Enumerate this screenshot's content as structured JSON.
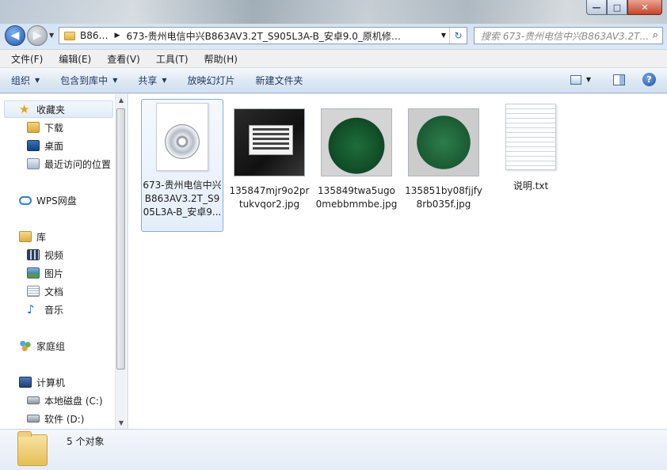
{
  "window": {
    "minimize": "—",
    "maximize": "□",
    "close": "✕"
  },
  "address": {
    "crumb1": "B86…",
    "crumb2": "673-贵州电信中兴B863AV3.2T_S905L3A-B_安卓9.0_原机修…",
    "search_placeholder": "搜索 673-贵州电信中兴B863AV3.2T…"
  },
  "menu": [
    "文件(F)",
    "编辑(E)",
    "查看(V)",
    "工具(T)",
    "帮助(H)"
  ],
  "toolbar": {
    "organize": "组织",
    "include_in_library": "包含到库中",
    "share": "共享",
    "slideshow": "放映幻灯片",
    "new_folder": "新建文件夹"
  },
  "nav": {
    "favorites": "收藏夹",
    "downloads": "下载",
    "desktop": "桌面",
    "recent": "最近访问的位置",
    "wps": "WPS网盘",
    "libraries": "库",
    "videos": "视频",
    "pictures": "图片",
    "documents": "文档",
    "music": "音乐",
    "homegroup": "家庭组",
    "computer": "计算机",
    "drive_c": "本地磁盘 (C:)",
    "drive_d": "软件 (D:)"
  },
  "files": [
    {
      "name": "673-贵州电信中兴B863AV3.2T_S905L3A-B_安卓9..."
    },
    {
      "name": "135847mjr9o2prtukvqor2.jpg"
    },
    {
      "name": "135849twa5ugo0mebbmmbe.jpg"
    },
    {
      "name": "135851by08fjjfy8rb035f.jpg"
    },
    {
      "name": "说明.txt"
    }
  ],
  "status": {
    "count": "5 个对象"
  },
  "icons": {
    "back": "arrow-left-icon",
    "forward": "arrow-right-icon",
    "refresh": "refresh-icon",
    "search": "search-icon",
    "help": "help-icon"
  }
}
